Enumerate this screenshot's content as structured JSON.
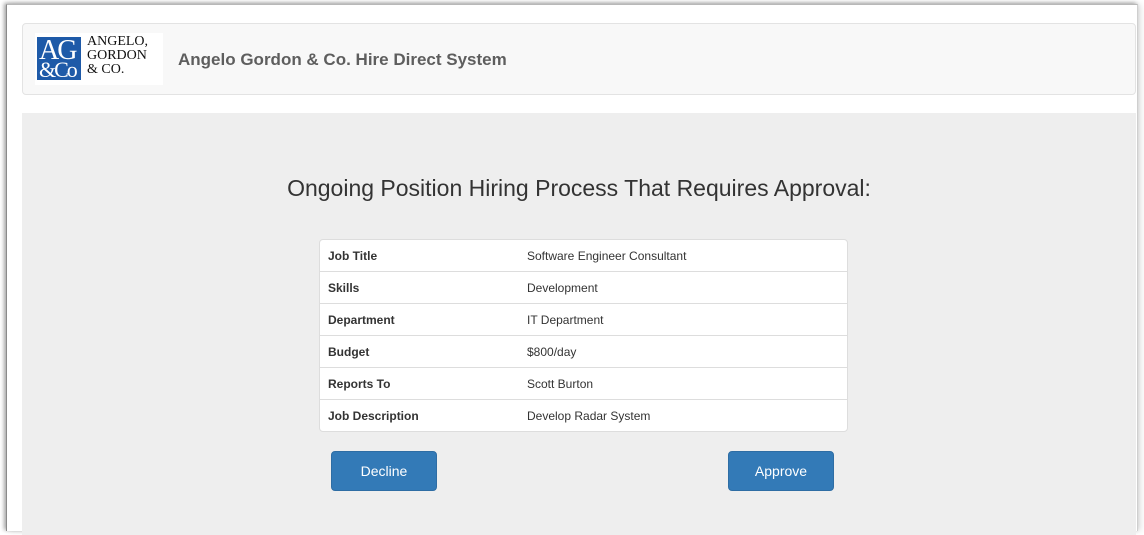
{
  "header": {
    "logo": {
      "mark_top": "AG",
      "mark_bottom": "&Co",
      "line1": "ANGELO,",
      "line2": "GORDON",
      "line3": "& CO."
    },
    "brand_title": "Angelo Gordon & Co. Hire Direct System"
  },
  "main": {
    "heading": "Ongoing Position Hiring Process That Requires Approval:",
    "details": [
      {
        "label": "Job Title",
        "value": "Software Engineer Consultant"
      },
      {
        "label": "Skills",
        "value": "Development"
      },
      {
        "label": "Department",
        "value": "IT Department"
      },
      {
        "label": "Budget",
        "value": "$800/day"
      },
      {
        "label": "Reports To",
        "value": "Scott Burton"
      },
      {
        "label": "Job Description",
        "value": "Develop Radar System"
      }
    ],
    "actions": {
      "decline_label": "Decline",
      "approve_label": "Approve"
    }
  },
  "colors": {
    "brand_blue": "#1e5aa8",
    "button_primary": "#337ab7",
    "panel_bg": "#eeeeee",
    "navbar_bg": "#f8f8f8"
  }
}
